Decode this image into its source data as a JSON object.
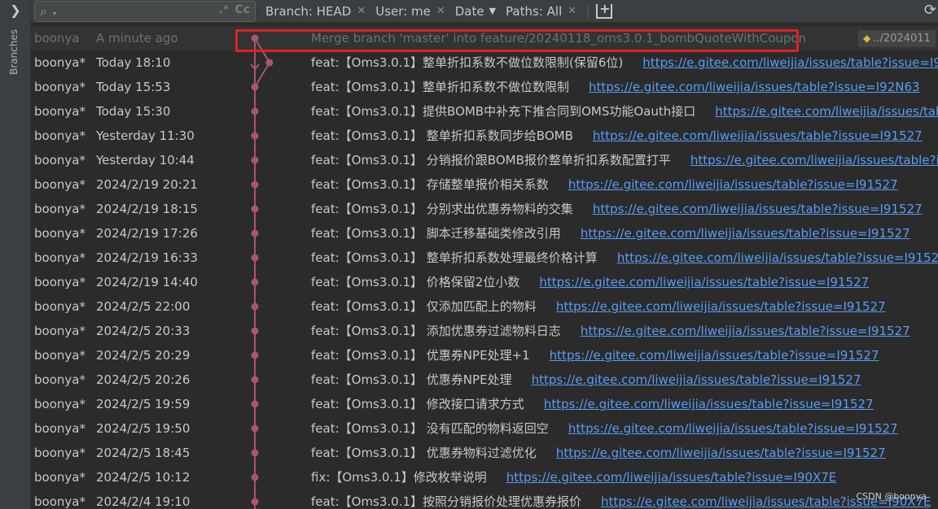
{
  "sidebar": {
    "label": "Branches"
  },
  "toolbar": {
    "search_placeholder": "",
    "regex_label": ".*",
    "case_label": "Cc",
    "filters": [
      {
        "label": "Branch: HEAD"
      },
      {
        "label": "User: me"
      },
      {
        "label": "Date"
      },
      {
        "label": "Paths: All"
      }
    ]
  },
  "commits": [
    {
      "author": "boonya",
      "date": "A minute ago",
      "message": "Merge branch 'master' into feature/20240118_oms3.0.1_bombQuoteWithCoupon",
      "link": "",
      "tag": "../2024011"
    },
    {
      "author": "boonya*",
      "date": "Today 18:10",
      "message": "feat:【Oms3.0.1】整单折扣系数不做位数限制(保留6位)",
      "link": "https://e.gitee.com/liweijia/issues/table?issue=I92"
    },
    {
      "author": "boonya*",
      "date": "Today 15:53",
      "message": "feat:【Oms3.0.1】整单折扣系数不做位数限制",
      "link": "https://e.gitee.com/liweijia/issues/table?issue=I92N63"
    },
    {
      "author": "boonya*",
      "date": "Today 15:30",
      "message": "feat:【Oms3.0.1】提供BOMB中补充下推合同到OMS功能Oauth接口",
      "link": "https://e.gitee.com/liweijia/issues/tab"
    },
    {
      "author": "boonya*",
      "date": "Yesterday 11:30",
      "message": "feat:【Oms3.0.1】 整单折扣系数同步给BOMB",
      "link": "https://e.gitee.com/liweijia/issues/table?issue=I91527"
    },
    {
      "author": "boonya*",
      "date": "Yesterday 10:44",
      "message": "feat:【Oms3.0.1】 分销报价跟BOMB报价整单折扣系数配置打平",
      "link": "https://e.gitee.com/liweijia/issues/table?is"
    },
    {
      "author": "boonya*",
      "date": "2024/2/19 20:21",
      "message": "feat:【Oms3.0.1】 存储整单报价相关系数",
      "link": "https://e.gitee.com/liweijia/issues/table?issue=I91527"
    },
    {
      "author": "boonya*",
      "date": "2024/2/19 18:15",
      "message": "feat:【Oms3.0.1】 分别求出优惠券物料的交集",
      "link": "https://e.gitee.com/liweijia/issues/table?issue=I91527"
    },
    {
      "author": "boonya*",
      "date": "2024/2/19 17:26",
      "message": "feat:【Oms3.0.1】 脚本迁移基础类修改引用",
      "link": "https://e.gitee.com/liweijia/issues/table?issue=I91527"
    },
    {
      "author": "boonya*",
      "date": "2024/2/19 16:33",
      "message": "feat:【Oms3.0.1】 整单折扣系数处理最终价格计算",
      "link": "https://e.gitee.com/liweijia/issues/table?issue=I91527"
    },
    {
      "author": "boonya*",
      "date": "2024/2/19 14:40",
      "message": "feat:【Oms3.0.1】 价格保留2位小数",
      "link": "https://e.gitee.com/liweijia/issues/table?issue=I91527"
    },
    {
      "author": "boonya*",
      "date": "2024/2/5 22:00",
      "message": "feat:【Oms3.0.1】 仅添加匹配上的物料",
      "link": "https://e.gitee.com/liweijia/issues/table?issue=I91527"
    },
    {
      "author": "boonya*",
      "date": "2024/2/5 20:33",
      "message": "feat:【Oms3.0.1】 添加优惠券过滤物料日志",
      "link": "https://e.gitee.com/liweijia/issues/table?issue=I91527"
    },
    {
      "author": "boonya*",
      "date": "2024/2/5 20:29",
      "message": "feat:【Oms3.0.1】 优惠券NPE处理+1",
      "link": "https://e.gitee.com/liweijia/issues/table?issue=I91527"
    },
    {
      "author": "boonya*",
      "date": "2024/2/5 20:26",
      "message": "feat:【Oms3.0.1】 优惠券NPE处理",
      "link": "https://e.gitee.com/liweijia/issues/table?issue=I91527"
    },
    {
      "author": "boonya*",
      "date": "2024/2/5 19:59",
      "message": "feat:【Oms3.0.1】 修改接口请求方式",
      "link": "https://e.gitee.com/liweijia/issues/table?issue=I91527"
    },
    {
      "author": "boonya*",
      "date": "2024/2/5 19:50",
      "message": "feat:【Oms3.0.1】 没有匹配的物料返回空",
      "link": "https://e.gitee.com/liweijia/issues/table?issue=I91527"
    },
    {
      "author": "boonya*",
      "date": "2024/2/5 18:45",
      "message": "feat:【Oms3.0.1】 优惠券物料过滤优化",
      "link": "https://e.gitee.com/liweijia/issues/table?issue=I91527"
    },
    {
      "author": "boonya*",
      "date": "2024/2/5 10:12",
      "message": "fix:【Oms3.0.1】修改枚举说明",
      "link": "https://e.gitee.com/liweijia/issues/table?issue=I90X7E"
    },
    {
      "author": "boonya*",
      "date": "2024/2/4 19:10",
      "message": "feat:【Oms3.0.1】按照分销报价处理优惠券报价",
      "link": "https://e.gitee.com/liweijia/issues/table?issue=I90X7E"
    }
  ],
  "watermark": "CSDN @boonya",
  "colors": {
    "graph": "#a8566a",
    "link": "#589df6",
    "highlight": "#e02020"
  }
}
